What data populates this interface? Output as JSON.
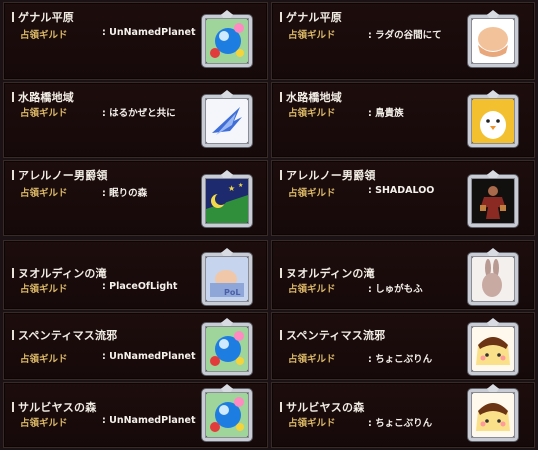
{
  "label_text": "占領ギルド",
  "separator": ":",
  "cards": [
    {
      "region": "ゲナル平原",
      "guild": "UnNamedPlanet",
      "emblem": "planet-flower-icon"
    },
    {
      "region": "ゲナル平原",
      "guild": "ラダの谷間にて",
      "emblem": "crossed-arms-icon"
    },
    {
      "region": "水路橋地域",
      "guild": "はるかぜと共に",
      "emblem": "wing-icon"
    },
    {
      "region": "水路橋地域",
      "guild": "鳥貴族",
      "emblem": "chick-icon"
    },
    {
      "region": "アレルノー男爵領",
      "guild": "眠りの森",
      "emblem": "moon-stars-icon"
    },
    {
      "region": "アレルノー男爵領",
      "guild": "SHADALOO",
      "emblem": "fighter-icon"
    },
    {
      "region": "ヌオルディンの滝",
      "guild": "PlaceOfLight",
      "emblem": "sleeping-pol-icon"
    },
    {
      "region": "ヌオルディンの滝",
      "guild": "しゅがもふ",
      "emblem": "rabbit-icon"
    },
    {
      "region": "スペンティマス流邪",
      "guild": "UnNamedPlanet",
      "emblem": "planet-flower-icon"
    },
    {
      "region": "スペンティマス流邪",
      "guild": "ちょこぷりん",
      "emblem": "pudding-icon"
    },
    {
      "region": "サルビヤスの森",
      "guild": "UnNamedPlanet",
      "emblem": "planet-flower-icon"
    },
    {
      "region": "サルビヤスの森",
      "guild": "ちょこぷりん",
      "emblem": "pudding-icon"
    }
  ]
}
